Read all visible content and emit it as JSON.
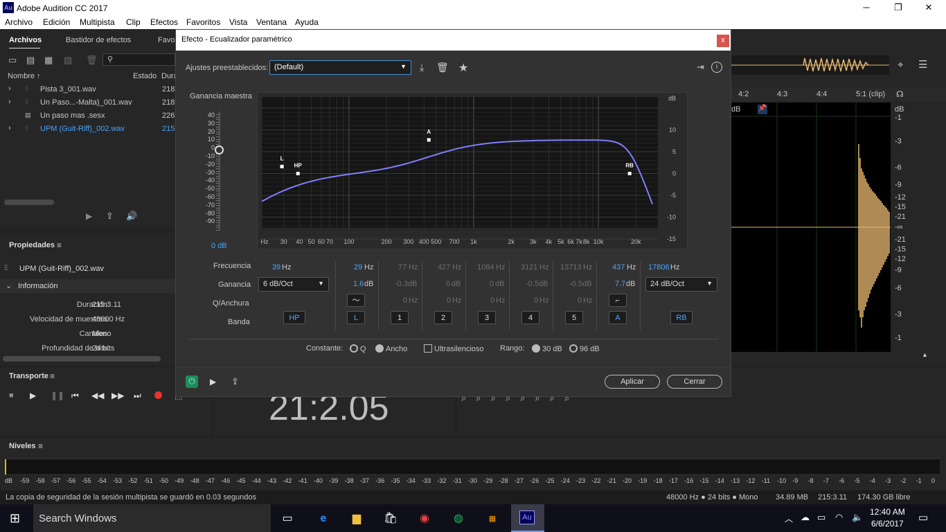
{
  "window": {
    "title": "Adobe Audition CC 2017",
    "icon_text": "Au",
    "min": "─",
    "max": "❐",
    "close": "✕"
  },
  "menu": [
    "Archivo",
    "Edición",
    "Multipista",
    "Clip",
    "Efectos",
    "Favoritos",
    "Vista",
    "Ventana",
    "Ayuda"
  ],
  "files": {
    "tabs": [
      "Archivos",
      "Bastidor de efectos",
      "Favor"
    ],
    "columns": {
      "name": "Nombre",
      "sort": "↑",
      "state": "Estado",
      "duration": "Dura"
    },
    "rows": [
      {
        "name": "Pista 3_001.wav",
        "dur": "218",
        "expand": "›",
        "selected": false
      },
      {
        "name": "Un Paso...-Malta)_001.wav",
        "dur": "218",
        "expand": "›",
        "selected": false
      },
      {
        "name": "Un paso mas .sesx",
        "dur": "226",
        "expand": "",
        "selected": false
      },
      {
        "name": "UPM (Guit-Riff)_002.wav",
        "dur": "215",
        "expand": "›",
        "selected": true
      }
    ]
  },
  "props": {
    "title": "Propiedades",
    "file": "UPM (Guit-Riff)_002.wav",
    "section": "Información",
    "items": [
      {
        "label": "Duración:",
        "value": "215:3.11"
      },
      {
        "label": "Velocidad de muestreo:",
        "value": "48000 Hz"
      },
      {
        "label": "Canales:",
        "value": "Mono"
      },
      {
        "label": "Profundidad de bits:",
        "value": "24 bits"
      }
    ]
  },
  "transport": {
    "title": "Transporte",
    "time": "21:2.05"
  },
  "levels": {
    "title": "Niveles",
    "scale": [
      "dB",
      "-59",
      "-58",
      "-57",
      "-56",
      "-55",
      "-54",
      "-53",
      "-52",
      "-51",
      "-50",
      "-49",
      "-48",
      "-47",
      "-46",
      "-45",
      "-44",
      "-43",
      "-42",
      "-41",
      "-40",
      "-39",
      "-38",
      "-37",
      "-36",
      "-35",
      "-34",
      "-33",
      "-32",
      "-31",
      "-30",
      "-29",
      "-28",
      "-27",
      "-26",
      "-25",
      "-24",
      "-23",
      "-22",
      "-21",
      "-20",
      "-19",
      "-18",
      "-17",
      "-16",
      "-15",
      "-14",
      "-13",
      "-12",
      "-11",
      "-10",
      "-9",
      "-8",
      "-7",
      "-6",
      "-5",
      "-4",
      "-3",
      "-2",
      "-1",
      "0"
    ]
  },
  "status": {
    "message": "La copia de seguridad de la sesión multipista se guardó en 0.03 segundos",
    "format": "48000 Hz ● 24 bits ● Mono",
    "size": "34.89 MB",
    "duration": "215:3.11",
    "free": "174.30 GB libre"
  },
  "editor": {
    "ruler": [
      "4:2",
      "4:3",
      "4:4",
      "5:1 (clip)"
    ],
    "db_unit": "dB",
    "db_scale": [
      "dB",
      "-1",
      "-3",
      "-6",
      "-9",
      "-12",
      "-15",
      "-21",
      "-∞",
      "-21",
      "-15",
      "-12",
      "-9",
      "-6",
      "-3",
      "-1"
    ],
    "db_label": "dB"
  },
  "dialog": {
    "title": "Efecto - Ecualizador paramétrico",
    "close": "x",
    "preset_label": "Ajustes preestablecidos:",
    "preset_value": "(Default)",
    "master_gain_label": "Ganancia maestra",
    "master_gain_value": "0 dB",
    "gain_scale": [
      "40",
      "30",
      "20",
      "10",
      "0",
      "-10",
      "-20",
      "-30",
      "-40",
      "-50",
      "-60",
      "-70",
      "-80",
      "-90"
    ],
    "graph": {
      "db_ticks": [
        "dB",
        "10",
        "5",
        "0",
        "-5",
        "-10",
        "-15"
      ],
      "freq_ticks": [
        "Hz",
        "30",
        "40",
        "50",
        "60",
        "70",
        "100",
        "200",
        "300",
        "400",
        "500",
        "700",
        "1k",
        "2k",
        "3k",
        "4k",
        "5k",
        "6k",
        "7k",
        "8k",
        "10k",
        "20k"
      ],
      "markers": [
        "L",
        "HP",
        "A",
        "RB"
      ]
    },
    "rows": {
      "freq": "Frecuencia",
      "gain": "Ganancia",
      "q": "Q/Anchura",
      "band": "Banda"
    },
    "hp": {
      "freq": "39",
      "slope": "6 dB/Oct",
      "band": "HP"
    },
    "bands": [
      {
        "freq": "29",
        "gain": "1.6",
        "q": "",
        "label": "L",
        "active": true
      },
      {
        "freq": "77",
        "gain": "-0.3",
        "q": "0",
        "label": "1",
        "active": false
      },
      {
        "freq": "427",
        "gain": "0",
        "q": "0",
        "label": "2",
        "active": false
      },
      {
        "freq": "1084",
        "gain": "0",
        "q": "0",
        "label": "3",
        "active": false
      },
      {
        "freq": "3121",
        "gain": "-0.5",
        "q": "0",
        "label": "4",
        "active": false
      },
      {
        "freq": "13713",
        "gain": "-0.5",
        "q": "0",
        "label": "5",
        "active": false
      },
      {
        "freq": "437",
        "gain": "7.7",
        "q": "",
        "label": "A",
        "active": true
      }
    ],
    "rb": {
      "freq": "17806",
      "slope": "24 dB/Oct",
      "band": "RB"
    },
    "units": {
      "hz": "Hz",
      "db": "dB"
    },
    "constant_label": "Constante:",
    "q_label": "Q",
    "width_label": "Ancho",
    "ultra_label": "Ultrasilencioso",
    "range_label": "Rango:",
    "range30": "30 dB",
    "range96": "96 dB",
    "apply": "Aplicar",
    "cancel": "Cerrar"
  },
  "taskbar": {
    "search": "Search Windows",
    "time": "12:40 AM",
    "date": "6/6/2017",
    "au": "Au"
  },
  "colors": {
    "accent": "#4aa3ff",
    "curve": "#7f7fff",
    "waveform": "#e8b870"
  }
}
